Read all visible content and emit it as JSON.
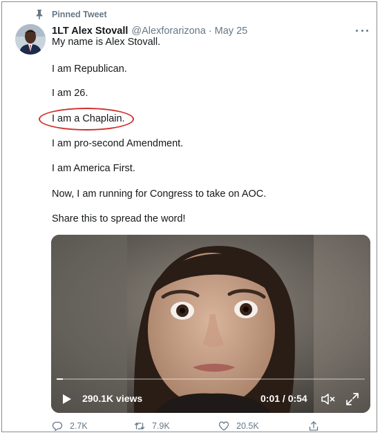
{
  "pinned_label": "Pinned Tweet",
  "tweet": {
    "display_name": "1LT Alex Stovall",
    "handle": "@Alexforarizona",
    "separator": "·",
    "date": "May 25",
    "lines": [
      "My name is Alex Stovall.",
      "I am Republican.",
      "I am 26.",
      "I am a Chaplain.",
      "I am pro-second Amendment.",
      "I am America First.",
      "Now, I am running for Congress to take on AOC.",
      "Share this to spread the word!"
    ]
  },
  "video": {
    "views": "290.1K views",
    "time": "0:01 / 0:54",
    "progress": 0.02
  },
  "actions": {
    "replies": "2.7K",
    "retweets": "7.9K",
    "likes": "20.5K"
  },
  "colors": {
    "annotation_circle": "#d0312d",
    "muted": "#657786"
  },
  "icons": [
    "pin-icon",
    "more-icon",
    "play-icon",
    "volume-icon",
    "fullscreen-icon",
    "reply-icon",
    "retweet-icon",
    "like-icon",
    "share-icon"
  ]
}
